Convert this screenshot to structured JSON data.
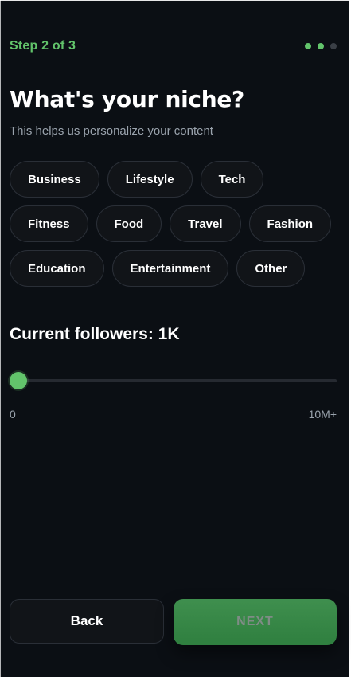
{
  "header": {
    "step_label": "Step 2 of 3",
    "progress": {
      "current": 2,
      "total": 3
    }
  },
  "main": {
    "title": "What's your niche?",
    "subtitle": "This helps us personalize your content",
    "niches": [
      [
        "Business",
        "Lifestyle",
        "Tech"
      ],
      [
        "Fitness",
        "Food",
        "Travel",
        "Fashion"
      ],
      [
        "Education",
        "Entertainment",
        "Other"
      ]
    ],
    "followers": {
      "label": "Current followers: 1K",
      "min_label": "0",
      "max_label": "10M+",
      "value_fraction": 0.0
    }
  },
  "footer": {
    "back_label": "Back",
    "next_label": "NEXT"
  },
  "colors": {
    "accent": "#62c46b",
    "background": "#0b0f14",
    "chip_border": "#2a2f37",
    "muted_text": "#9aa3ad"
  }
}
